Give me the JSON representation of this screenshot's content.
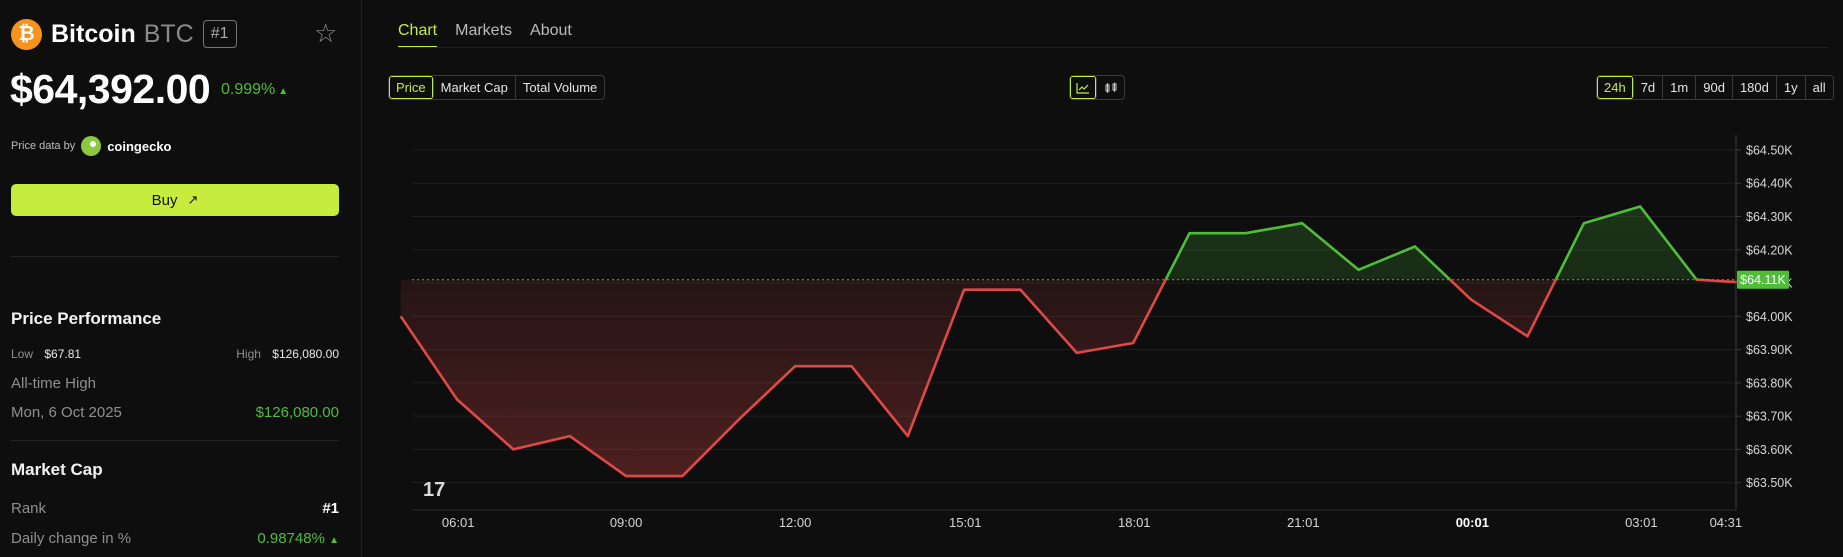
{
  "coin": {
    "logo_glyph": "₿",
    "name": "Bitcoin",
    "symbol": "BTC",
    "rank": "#1",
    "price": "$64,392.00",
    "change": "0.999%",
    "change_arrow": "▲",
    "favorite_glyph": "☆"
  },
  "price_data": {
    "label": "Price data by",
    "source": "coingecko"
  },
  "buy": {
    "label": "Buy",
    "arrow": "↗"
  },
  "performance": {
    "title": "Price Performance",
    "low_label": "Low",
    "low_value": "$67.81",
    "high_label": "High",
    "high_value": "$126,080.00",
    "ath_label": "All-time High",
    "ath_date": "Mon, 6 Oct 2025",
    "ath_value": "$126,080.00"
  },
  "market_cap": {
    "title": "Market Cap",
    "rank_label": "Rank",
    "rank_value": "#1",
    "daily_label": "Daily change in %",
    "daily_value": "0.98748%",
    "daily_arrow": "▲"
  },
  "tabs": [
    {
      "label": "Chart",
      "active": true
    },
    {
      "label": "Markets",
      "active": false
    },
    {
      "label": "About",
      "active": false
    }
  ],
  "metrics": [
    {
      "label": "Price",
      "active": true
    },
    {
      "label": "Market Cap",
      "active": false
    },
    {
      "label": "Total Volume",
      "active": false
    }
  ],
  "chart_types": [
    {
      "icon": "line-chart-icon",
      "active": true
    },
    {
      "icon": "candlestick-icon",
      "active": false
    }
  ],
  "ranges": [
    {
      "label": "24h",
      "active": true
    },
    {
      "label": "7d",
      "active": false
    },
    {
      "label": "1m",
      "active": false
    },
    {
      "label": "90d",
      "active": false
    },
    {
      "label": "180d",
      "active": false
    },
    {
      "label": "1y",
      "active": false
    },
    {
      "label": "all",
      "active": false
    }
  ],
  "colors": {
    "accent": "#c6ec3d",
    "up": "#4fbd3a",
    "down": "#e04848",
    "background": "#0e0e0e"
  },
  "chart_data": {
    "type": "line",
    "title": "",
    "xlabel": "",
    "ylabel": "",
    "baseline": 64.11,
    "current_label": "$64.11K",
    "ylim": [
      63.43,
      64.56
    ],
    "xlim": [
      5.2,
      28.7
    ],
    "y_ticks": [
      63.5,
      63.6,
      63.7,
      63.8,
      63.9,
      64.0,
      64.1,
      64.2,
      64.3,
      64.4,
      64.5
    ],
    "y_tick_labels": [
      "$63.50K",
      "$63.60K",
      "$63.70K",
      "$63.80K",
      "$63.90K",
      "$64.00K",
      "$64.10K",
      "$64.20K",
      "$64.30K",
      "$64.40K",
      "$64.50K"
    ],
    "x_ticks": [
      {
        "x": 6.02,
        "label": "06:01",
        "bold": false
      },
      {
        "x": 9.0,
        "label": "09:00",
        "bold": false
      },
      {
        "x": 12.0,
        "label": "12:00",
        "bold": false
      },
      {
        "x": 15.02,
        "label": "15:01",
        "bold": false
      },
      {
        "x": 18.02,
        "label": "18:01",
        "bold": false
      },
      {
        "x": 21.02,
        "label": "21:01",
        "bold": false
      },
      {
        "x": 24.02,
        "label": "00:01",
        "bold": true
      },
      {
        "x": 27.02,
        "label": "03:01",
        "bold": false
      },
      {
        "x": 28.52,
        "label": "04:31",
        "bold": false
      }
    ],
    "series": [
      {
        "x": [
          5.0,
          6.0,
          7.0,
          8.0,
          9.0,
          10.0,
          11.0,
          12.0,
          13.0,
          14.0,
          15.0,
          16.0,
          17.0,
          18.0,
          19.0,
          20.0,
          21.0,
          22.0,
          23.0,
          24.0,
          25.0,
          26.0,
          27.0,
          28.0,
          29.0
        ],
        "values": [
          64.0,
          63.75,
          63.6,
          63.64,
          63.52,
          63.52,
          63.69,
          63.85,
          63.85,
          63.64,
          64.08,
          64.08,
          63.89,
          63.92,
          64.25,
          64.25,
          64.28,
          64.14,
          64.21,
          64.05,
          63.94,
          64.28,
          64.33,
          64.11,
          64.1
        ]
      }
    ]
  }
}
